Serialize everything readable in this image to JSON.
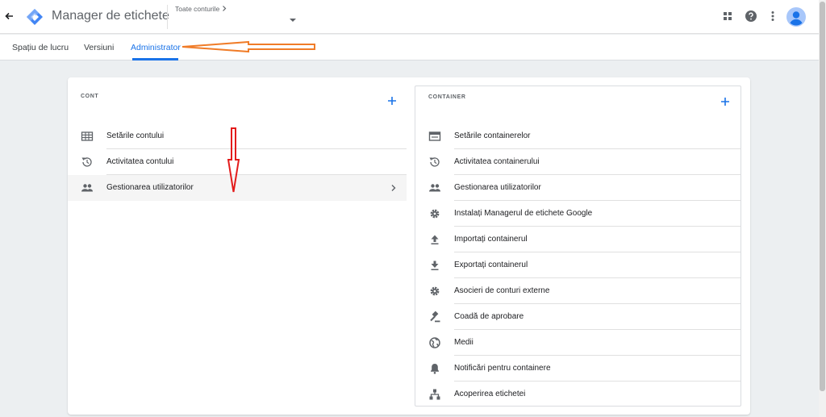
{
  "header": {
    "app_title": "Manager de etichete",
    "account_link": "Toate conturile",
    "icons": [
      "back-arrow-icon",
      "gtm-logo-icon",
      "apps-grid-icon",
      "help-icon",
      "more-vert-icon",
      "account-avatar-icon"
    ]
  },
  "tabs": [
    {
      "label": "Spațiu de lucru"
    },
    {
      "label": "Versiuni"
    },
    {
      "label": "Administrator"
    }
  ],
  "account_panel": {
    "title": "CONT",
    "items": [
      {
        "label": "Setările contului",
        "icon": "table-icon"
      },
      {
        "label": "Activitatea contului",
        "icon": "history-icon"
      },
      {
        "label": "Gestionarea utilizatorilor",
        "icon": "people-icon"
      }
    ]
  },
  "container_panel": {
    "title": "CONTAINER",
    "items": [
      {
        "label": "Setările containerelor",
        "icon": "window-icon"
      },
      {
        "label": "Activitatea containerului",
        "icon": "history-icon"
      },
      {
        "label": "Gestionarea utilizatorilor",
        "icon": "people-icon"
      },
      {
        "label": "Instalați Managerul de etichete Google",
        "icon": "gear-icon"
      },
      {
        "label": "Importați containerul",
        "icon": "upload-icon"
      },
      {
        "label": "Exportați containerul",
        "icon": "download-icon"
      },
      {
        "label": "Asocieri de conturi externe",
        "icon": "gear-icon"
      },
      {
        "label": "Coadă de aprobare",
        "icon": "gavel-icon"
      },
      {
        "label": "Medii",
        "icon": "globe-icon"
      },
      {
        "label": "Notificări pentru containere",
        "icon": "bell-icon"
      },
      {
        "label": "Acoperirea etichetei",
        "icon": "sitemap-icon"
      }
    ]
  },
  "colors": {
    "accent": "#1a73e8",
    "background": "#eceff1",
    "annotation_orange": "#f07c28",
    "annotation_red": "#e31b1b"
  }
}
